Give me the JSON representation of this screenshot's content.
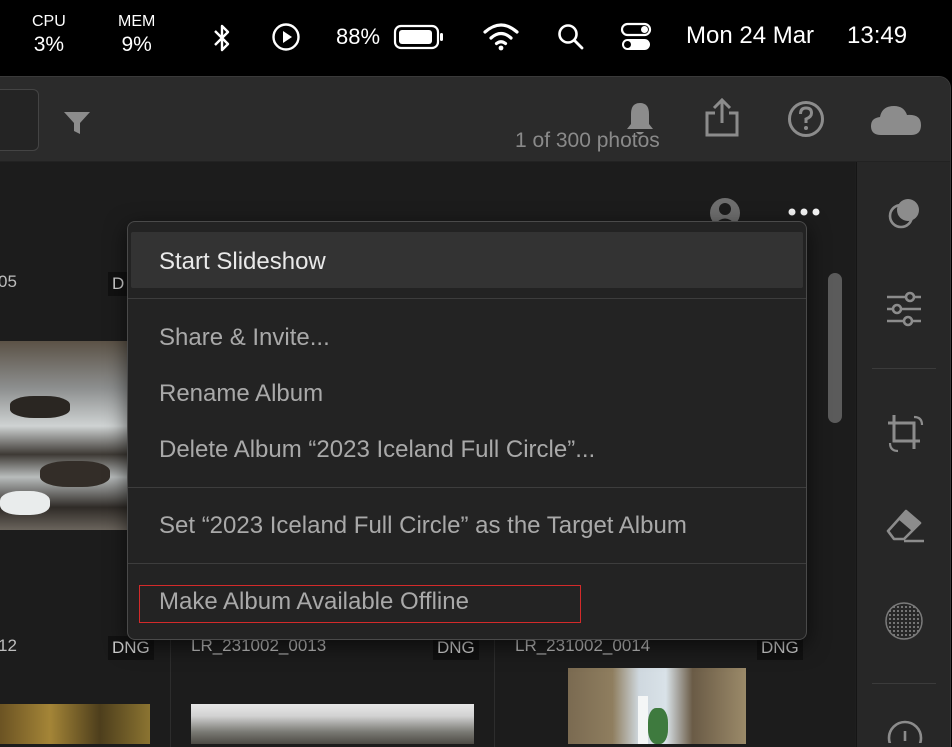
{
  "menubar": {
    "cpu_label": "CPU",
    "cpu_value": "3%",
    "mem_label": "MEM",
    "mem_value": "9%",
    "battery": "88%",
    "date": "Mon 24 Mar",
    "time": "13:49",
    "icons": [
      "bluetooth-icon",
      "play-circle-icon",
      "battery-icon",
      "wifi-icon",
      "search-icon",
      "control-center-icon"
    ]
  },
  "toolbar": {
    "icons": [
      "filter-icon",
      "bell-icon",
      "share-icon",
      "help-icon",
      "cloud-icon"
    ]
  },
  "grid": {
    "photo_count": "1 of 300 photos",
    "cells": [
      {
        "label": "05",
        "badge": "D"
      },
      {
        "label": "12",
        "badge": "DNG"
      },
      {
        "label": "LR_231002_0013",
        "badge": "DNG"
      },
      {
        "label": "LR_231002_0014",
        "badge": "DNG"
      }
    ]
  },
  "rail": {
    "icons": [
      "mask-icon",
      "sliders-icon",
      "crop-icon",
      "eraser-icon",
      "dot-grid-icon",
      "info-icon"
    ]
  },
  "menu": {
    "items": [
      {
        "label": "Start Slideshow"
      },
      {
        "label": "Share & Invite..."
      },
      {
        "label": "Rename Album"
      },
      {
        "label": "Delete Album “2023 Iceland Full Circle”..."
      },
      {
        "label": "Set “2023 Iceland Full Circle” as the Target Album"
      },
      {
        "label": "Make Album Available Offline"
      }
    ]
  },
  "colors": {
    "accent_highlight": "#d32a2a",
    "menu_bg": "#232323",
    "toolbar_bg": "#2b2b2b"
  }
}
